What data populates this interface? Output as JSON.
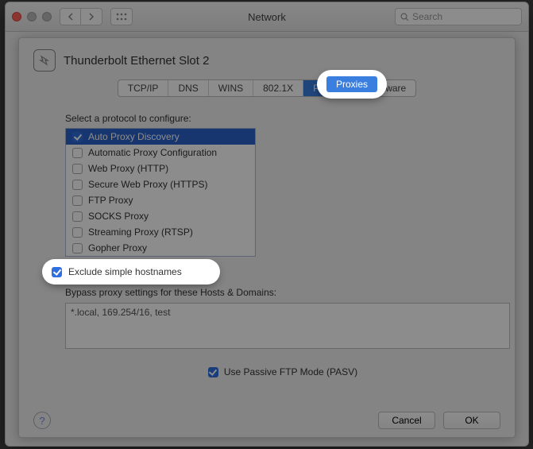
{
  "window": {
    "title": "Network",
    "search_placeholder": "Search"
  },
  "sheet": {
    "title": "Thunderbolt Ethernet Slot 2",
    "tabs": [
      "TCP/IP",
      "DNS",
      "WINS",
      "802.1X",
      "Proxies",
      "Hardware"
    ],
    "active_tab": "Proxies",
    "protocol_label": "Select a protocol to configure:",
    "protocols": [
      {
        "label": "Auto Proxy Discovery",
        "checked": true,
        "selected": true
      },
      {
        "label": "Automatic Proxy Configuration",
        "checked": false,
        "selected": false
      },
      {
        "label": "Web Proxy (HTTP)",
        "checked": false,
        "selected": false
      },
      {
        "label": "Secure Web Proxy (HTTPS)",
        "checked": false,
        "selected": false
      },
      {
        "label": "FTP Proxy",
        "checked": false,
        "selected": false
      },
      {
        "label": "SOCKS Proxy",
        "checked": false,
        "selected": false
      },
      {
        "label": "Streaming Proxy (RTSP)",
        "checked": false,
        "selected": false
      },
      {
        "label": "Gopher Proxy",
        "checked": false,
        "selected": false
      }
    ],
    "exclude_simple": {
      "label": "Exclude simple hostnames",
      "checked": true
    },
    "bypass_label": "Bypass proxy settings for these Hosts & Domains:",
    "bypass_value": "*.local, 169.254/16, test",
    "passive_ftp": {
      "label": "Use Passive FTP Mode (PASV)",
      "checked": true
    },
    "buttons": {
      "cancel": "Cancel",
      "ok": "OK"
    }
  }
}
